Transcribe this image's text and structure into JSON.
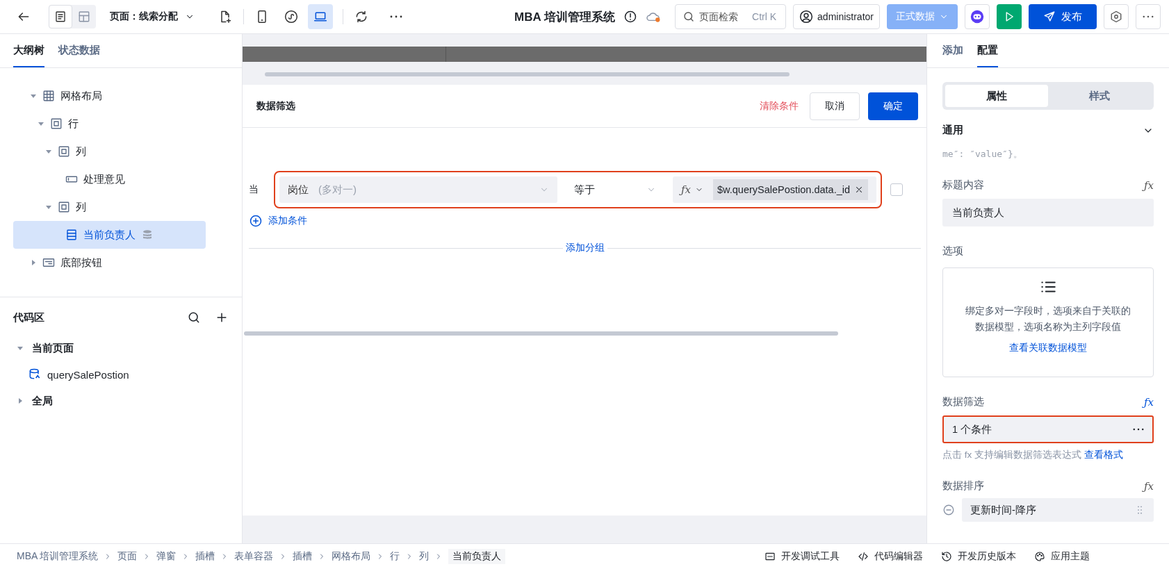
{
  "topbar": {
    "view_modes": [
      {
        "kind": "page",
        "selected": true
      },
      {
        "kind": "layout",
        "selected": false
      }
    ],
    "page_selector": "页面：线索分配",
    "devices": [
      {
        "kind": "phone",
        "selected": false
      },
      {
        "kind": "mini-program",
        "selected": false
      },
      {
        "kind": "desktop",
        "selected": true
      }
    ],
    "title": "MBA 培训管理系统",
    "search": {
      "placeholder": "页面检索",
      "shortcut": "Ctrl K"
    },
    "user": "administrator",
    "environment": "正式数据",
    "publish": "发布"
  },
  "outline": {
    "tabs": [
      {
        "label": "大纲树",
        "selected": true
      },
      {
        "label": "状态数据",
        "selected": false
      }
    ],
    "tree": [
      {
        "label": "网格布局",
        "kind": "grid",
        "expanded": true,
        "children": [
          {
            "label": "行",
            "kind": "container",
            "expanded": true,
            "children": [
              {
                "label": "列",
                "kind": "container",
                "expanded": true,
                "children": [
                  {
                    "label": "处理意见",
                    "kind": "input",
                    "selected": false
                  }
                ]
              },
              {
                "label": "列",
                "kind": "container",
                "expanded": true,
                "children": [
                  {
                    "label": "当前负责人",
                    "kind": "select",
                    "selected": true
                  }
                ]
              }
            ]
          }
        ]
      },
      {
        "label": "底部按钮",
        "kind": "form",
        "expanded": false
      }
    ]
  },
  "code_area": {
    "title": "代码区",
    "groups": [
      {
        "label": "当前页面",
        "expanded": true,
        "children": [
          {
            "label": "querySalePostion"
          }
        ]
      },
      {
        "label": "全局",
        "expanded": false
      }
    ]
  },
  "filter_dialog": {
    "title": "数据筛选",
    "clear": "清除条件",
    "cancel": "取消",
    "confirm": "确定",
    "condition": {
      "prefix": "当",
      "field": "岗位",
      "field_hint": "(多对一)",
      "operator": "等于",
      "formula": "ƒx",
      "value": "$w.querySalePostion.data._id",
      "checked": false,
      "highlighted": true
    },
    "add_condition": "添加条件",
    "add_group": "添加分组"
  },
  "inspector": {
    "tabs": [
      {
        "label": "添加",
        "selected": false
      },
      {
        "label": "配置",
        "selected": true
      }
    ],
    "segments": [
      {
        "label": "属性",
        "selected": true
      },
      {
        "label": "样式",
        "selected": false
      }
    ],
    "section": {
      "title": "通用",
      "expanded": true
    },
    "snippet": "me″: ″value″}。",
    "fields": [
      {
        "kind": "text",
        "label": "标题内容",
        "formula": "ƒx",
        "formula_active": false,
        "value": "当前负责人"
      },
      {
        "kind": "options",
        "label": "选项",
        "note": "绑定多对一字段时，选项来自于关联的数据模型，选项名称为主列字段值",
        "link": "查看关联数据模型"
      },
      {
        "kind": "filter",
        "label": "数据筛选",
        "formula": "ƒx",
        "formula_active": true,
        "value": "1 个条件",
        "highlighted": true,
        "hint": "点击 fx 支持编辑数据筛选表达式",
        "link": "查看格式"
      },
      {
        "kind": "sort",
        "label": "数据排序",
        "formula": "ƒx",
        "formula_active": false,
        "items": [
          "更新时间-降序"
        ]
      }
    ]
  },
  "status_bar": {
    "breadcrumb": [
      "MBA 培训管理系统",
      "页面",
      "弹窗",
      "插槽",
      "表单容器",
      "插槽",
      "网格布局",
      "行",
      "列",
      "当前负责人"
    ],
    "tools": [
      {
        "kind": "debug",
        "label": "开发调试工具"
      },
      {
        "kind": "code",
        "label": "代码编辑器"
      },
      {
        "kind": "history",
        "label": "开发历史版本"
      },
      {
        "kind": "theme",
        "label": "应用主题"
      }
    ]
  }
}
